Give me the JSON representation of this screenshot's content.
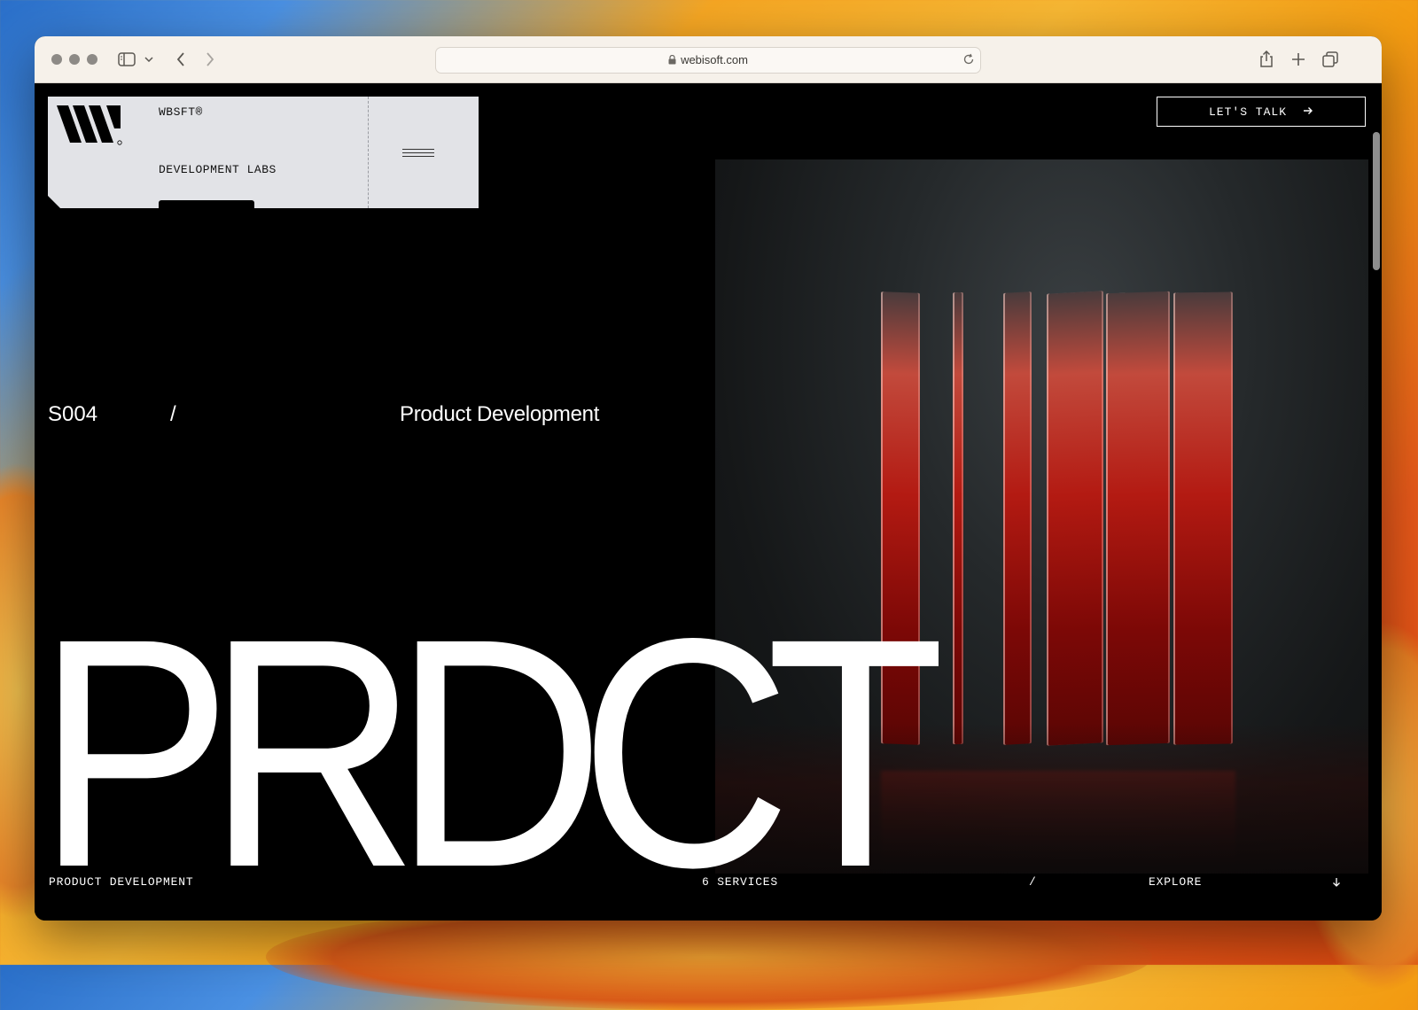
{
  "browser": {
    "url": "webisoft.com",
    "icons": [
      "sidebar-icon",
      "chevron-down-icon",
      "back-icon",
      "forward-icon",
      "lock-icon",
      "reload-icon",
      "share-icon",
      "plus-icon",
      "tabs-icon"
    ]
  },
  "header": {
    "brand_name": "WBSFT®",
    "brand_subtitle": "DEVELOPMENT LABS",
    "cta_label": "LET'S TALK",
    "cta_icon": "arrow-right-icon",
    "menu_icon": "hamburger-icon"
  },
  "hero": {
    "service_code": "S004",
    "separator": "/",
    "service_name": "Product Development",
    "big_title": "PRDCT",
    "image_desc_colors": [
      "#b31a12",
      "#25292b"
    ]
  },
  "footer": {
    "left_label": "PRODUCT DEVELOPMENT",
    "count_label": "6 SERVICES",
    "separator": "/",
    "explore_label": "EXPLORE",
    "explore_icon": "arrow-down-icon"
  }
}
